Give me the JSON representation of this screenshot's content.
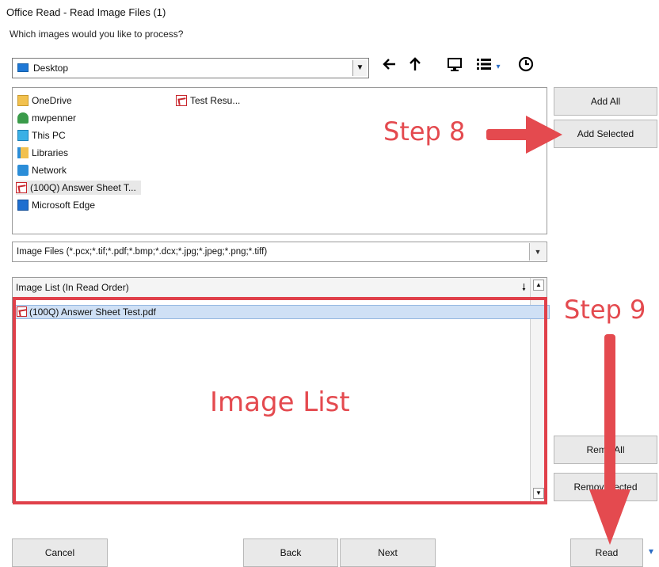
{
  "window": {
    "title": "Office Read - Read Image Files (1)",
    "prompt": "Which images would you like to process?"
  },
  "location": {
    "value": "Desktop"
  },
  "nav_icons": [
    "back-arrow-icon",
    "up-arrow-icon",
    "desktop-icon",
    "view-list-icon",
    "view-dropdown-icon",
    "history-icon"
  ],
  "browser": {
    "items": [
      {
        "label": "OneDrive",
        "icon": "folder-icon"
      },
      {
        "label": "mwpenner",
        "icon": "user-icon"
      },
      {
        "label": "This PC",
        "icon": "computer-icon"
      },
      {
        "label": "Libraries",
        "icon": "libraries-icon"
      },
      {
        "label": "Network",
        "icon": "network-icon"
      },
      {
        "label": "(100Q) Answer Sheet T...",
        "icon": "pdf-icon"
      },
      {
        "label": "Microsoft Edge",
        "icon": "edge-icon"
      },
      {
        "label": "Test Resu...",
        "icon": "pdf-icon"
      }
    ]
  },
  "buttons": {
    "add_all": "Add All",
    "add_selected": "Add Selected",
    "remove_all": "Remo    All",
    "remove_selected": "Remove      lected",
    "cancel": "Cancel",
    "back": "Back",
    "next": "Next",
    "read": "Read"
  },
  "filter": {
    "value": "Image Files (*.pcx;*.tif;*.pdf;*.bmp;*.dcx;*.jpg;*.jpeg;*.png;*.tiff)"
  },
  "image_list": {
    "header": "Image List (In Read Order)",
    "items": [
      "(100Q) Answer Sheet Test.pdf"
    ]
  },
  "annotations": {
    "step8": "Step 8",
    "step9": "Step 9",
    "image_list_label": "Image List"
  },
  "colors": {
    "annotation_red": "#e44a4f",
    "selection_blue": "#cfe0f5"
  }
}
